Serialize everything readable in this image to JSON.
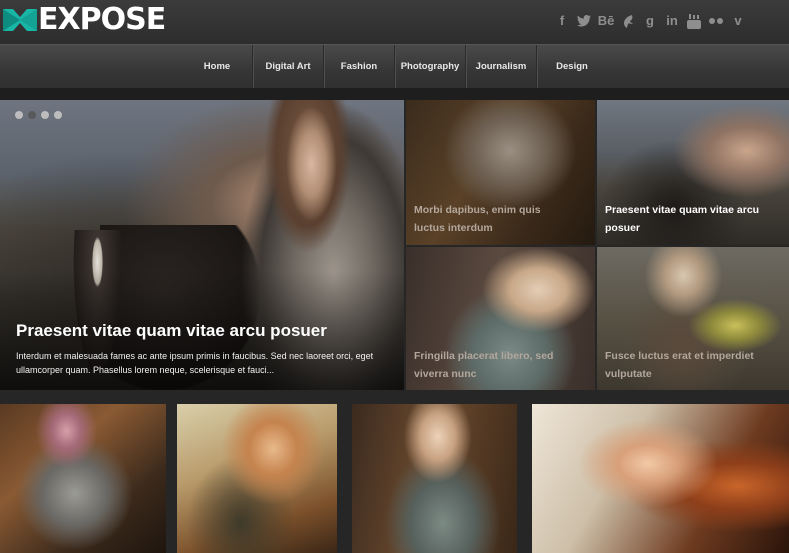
{
  "header": {
    "logo_text": "EXPOSE",
    "social_icons": [
      "facebook-icon",
      "twitter-icon",
      "behance-icon",
      "deviantart-icon",
      "google-plus-icon",
      "linkedin-icon",
      "youtube-icon",
      "flickr-icon",
      "vimeo-icon"
    ],
    "social_glyphs": {
      "facebook": "f",
      "behance": "Bē",
      "google": "g",
      "linkedin": "in",
      "vimeo": "v"
    },
    "accent_color": "#19b5a6"
  },
  "nav": {
    "items": [
      {
        "label": "Home"
      },
      {
        "label": "Digital Art"
      },
      {
        "label": "Fashion"
      },
      {
        "label": "Photography"
      },
      {
        "label": "Journalism"
      },
      {
        "label": "Design"
      }
    ]
  },
  "slider": {
    "dots": 4,
    "active_dot": 2,
    "title": "Praesent vitae quam vitae arcu posuer",
    "excerpt": "Interdum et malesuada fames ac ante ipsum primis in faucibus. Sed nec laoreet orci, eget ullamcorper quam. Phasellus lorem neque, scelerisque et fauci..."
  },
  "featured_posts": [
    {
      "title": "Morbi dapibus, enim quis luctus interdum"
    },
    {
      "title": "Praesent vitae quam vitae arcu posuer"
    },
    {
      "title": "Fringilla placerat libero, sed viverra nunc"
    },
    {
      "title": "Fusce luctus erat et imperdiet vulputate"
    }
  ]
}
